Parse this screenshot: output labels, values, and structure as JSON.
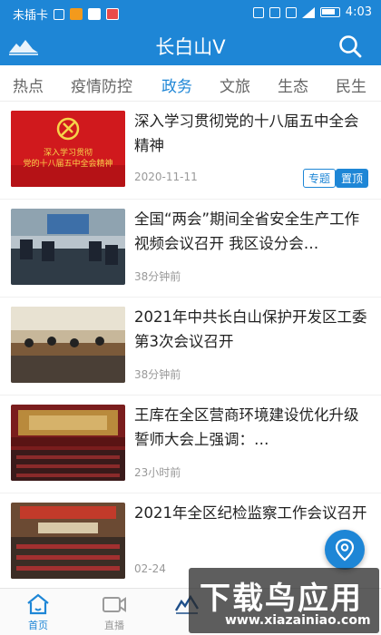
{
  "status_bar": {
    "carrier": "未插卡",
    "time": "4:03",
    "battery_icon": "battery-icon",
    "wifi_icon": "wifi-icon"
  },
  "header": {
    "title": "长白山V",
    "search_icon": "search-icon",
    "logo_icon": "changbaishan-logo-icon"
  },
  "tabs": [
    {
      "label": "热点",
      "active": false
    },
    {
      "label": "疫情防控",
      "active": false
    },
    {
      "label": "政务",
      "active": true
    },
    {
      "label": "文旅",
      "active": false
    },
    {
      "label": "生态",
      "active": false
    },
    {
      "label": "民生",
      "active": false
    }
  ],
  "news": [
    {
      "title": "深入学习贯彻党的十八届五中全会精神",
      "time": "2020-11-11",
      "badge_topic": "专题",
      "badge_pin": "置顶",
      "thumb_caption_1": "深入学习贯彻",
      "thumb_caption_2": "党的十八届五中全会精神"
    },
    {
      "title": "全国“两会”期间全省安全生产工作视频会议召开 我区设分会…",
      "time": "38分钟前"
    },
    {
      "title": "2021年中共长白山保护开发区工委第3次会议召开",
      "time": "38分钟前"
    },
    {
      "title": "王库在全区营商环境建设优化升级誓师大会上强调：…",
      "time": "23小时前"
    },
    {
      "title": "2021年全区纪检监察工作会议召开",
      "time": "02-24"
    }
  ],
  "fab": {
    "icon": "location-pin-icon"
  },
  "bottom_nav": [
    {
      "label": "首页",
      "icon": "home-icon",
      "active": true
    },
    {
      "label": "直播",
      "icon": "video-camera-icon",
      "active": false
    },
    {
      "label": "",
      "icon": "center-logo-icon",
      "active": false
    }
  ],
  "watermark": {
    "text": "下载鸟应用",
    "url": "www.xiazainiao.com"
  },
  "colors": {
    "primary": "#1e86d6",
    "text": "#222222",
    "muted": "#999999"
  }
}
